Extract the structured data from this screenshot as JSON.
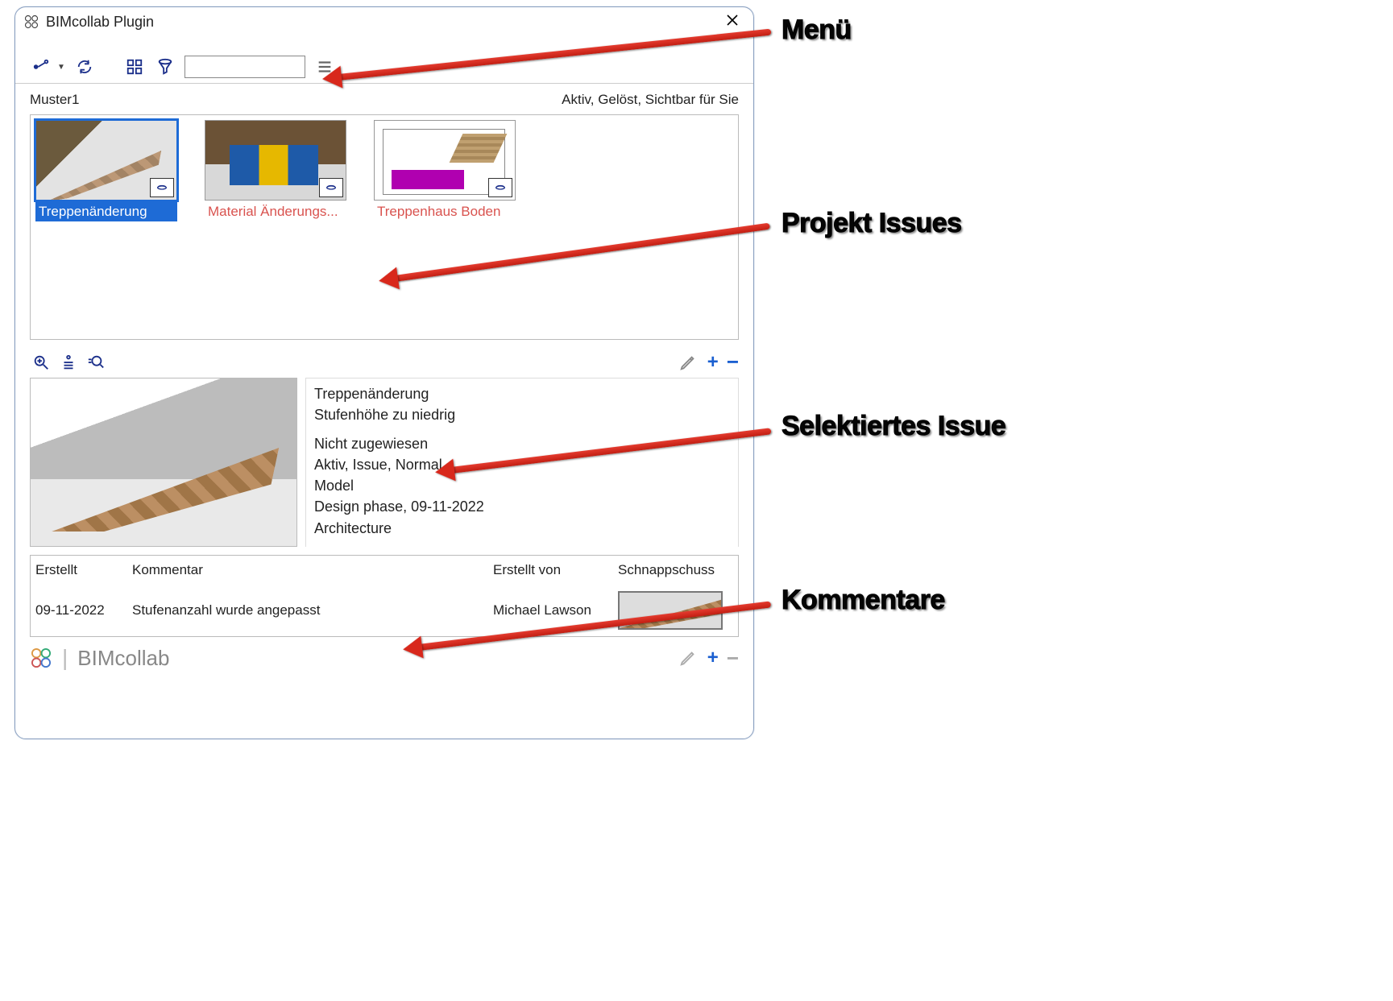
{
  "window": {
    "title": "BIMcollab Plugin"
  },
  "subheader": {
    "project": "Muster1",
    "filter_status": "Aktiv, Gelöst, Sichtbar für Sie"
  },
  "issues": [
    {
      "label": "Treppenänderung",
      "selected": true
    },
    {
      "label": "Material Änderungs...",
      "selected": false
    },
    {
      "label": "Treppenhaus Boden",
      "selected": false
    }
  ],
  "detail": {
    "title": "Treppenänderung",
    "subtitle": "Stufenhöhe zu niedrig",
    "assigned": "Nicht zugewiesen",
    "status_line": "Aktiv, Issue, Normal",
    "milestone": "Model",
    "phase_date": "Design phase, 09-11-2022",
    "discipline": "Architecture"
  },
  "comments": {
    "headers": {
      "date": "Erstellt",
      "comment": "Kommentar",
      "author": "Erstellt von",
      "snapshot": "Schnappschuss"
    },
    "rows": [
      {
        "date": "09-11-2022",
        "comment": "Stufenanzahl wurde angepasst",
        "author": "Michael Lawson"
      }
    ]
  },
  "footer": {
    "brand": "BIMcollab"
  },
  "annotations": {
    "menu": "Menü",
    "issues": "Projekt Issues",
    "selected": "Selektiertes Issue",
    "comments": "Kommentare"
  }
}
